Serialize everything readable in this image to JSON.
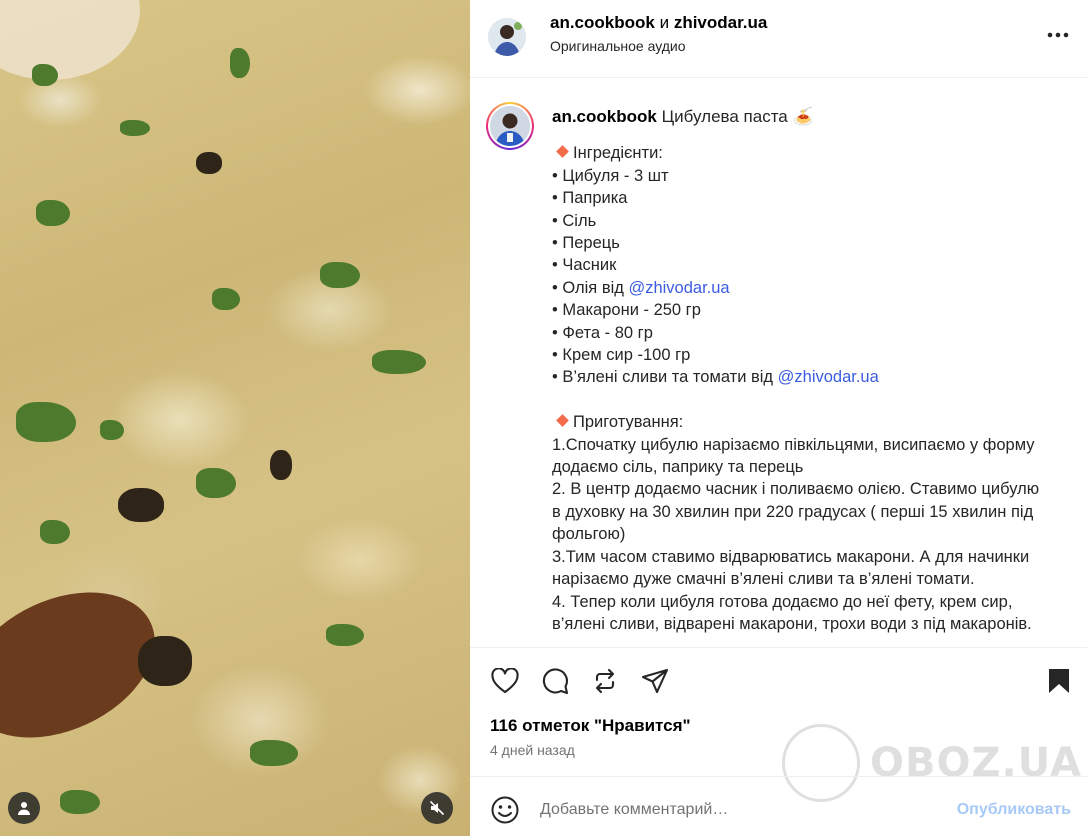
{
  "header": {
    "author1": "an.cookbook",
    "joiner": "и",
    "author2": "zhivodar.ua",
    "audio": "Оригинальное аудио"
  },
  "caption": {
    "username": "an.cookbook",
    "title": "Цибулева паста 🍝",
    "ingredients_heading": "Інгредієнти:",
    "ingredients": [
      {
        "text": "• Цибуля - 3 шт"
      },
      {
        "text": "• Паприка"
      },
      {
        "text": "• Сіль"
      },
      {
        "text": "• Перець"
      },
      {
        "text": "• Часник"
      },
      {
        "text": "• Олія від ",
        "mention": "@zhivodar.ua"
      },
      {
        "text": "• Макарони - 250 гр"
      },
      {
        "text": "• Фета - 80 гр"
      },
      {
        "text": "• Крем сир -100 гр"
      },
      {
        "text": "• В’ялені сливи та томати від ",
        "mention": "@zhivodar.ua"
      }
    ],
    "steps_heading": "Приготування:",
    "steps": [
      "1.Спочатку цибулю нарізаємо півкільцями, висипаємо у форму",
      "додаємо сіль, паприку та перець",
      "2. В центр додаємо часник і поливаємо олією. Ставимо цибулю",
      "в духовку на 30 хвилин при 220 градусах ( перші 15 хвилин під",
      "фольгою)",
      "3.Тим часом ставимо відварюватись макарони. А для начинки",
      "нарізаємо дуже смачні в’ялені сливи та в’ялені томати.",
      "4. Тепер коли цибуля готова додаємо до неї фету, крем сир,",
      "в’ялені сливи, відварені макарони, трохи води з під макаронів."
    ]
  },
  "stats": {
    "likes": "116 отметок \"Нравится\"",
    "date": "4 дней назад"
  },
  "comment": {
    "placeholder": "Добавьте комментарий…",
    "post_label": "Опубликовать"
  },
  "watermark": "OBOZ.UA",
  "icons": {
    "like": "heart-icon",
    "comment": "comment-icon",
    "share": "repost-icon",
    "send": "send-icon",
    "save": "bookmark-icon",
    "more": "more-icon",
    "emoji": "emoji-icon",
    "mute": "muted-speaker-icon",
    "user": "user-icon"
  },
  "colors": {
    "mention": "#3b5ce0",
    "post_disabled": "#a7c9f7",
    "bullet_diamond": "#f46b4a"
  }
}
